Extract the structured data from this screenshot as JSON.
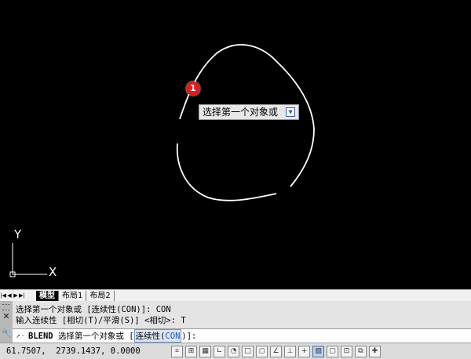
{
  "canvas": {
    "step_badge": "1",
    "tooltip": {
      "text": "选择第一个对象或"
    },
    "ucs": {
      "y_label": "Y",
      "x_label": "X"
    }
  },
  "tabs": [
    {
      "label": "模型",
      "active": true
    },
    {
      "label": "布局1",
      "active": false
    },
    {
      "label": "布局2",
      "active": false
    }
  ],
  "command": {
    "history": [
      "选择第一个对象或 [连续性(CON)]: CON",
      "输入连续性 [相切(T)/平滑(S)] <相切>: T"
    ],
    "current": {
      "name": "BLEND",
      "prompt": "选择第一个对象或",
      "option_open": "[",
      "option_text": "连续性(",
      "option_key": "CON",
      "option_close": ")]:",
      "close": ""
    }
  },
  "status": {
    "coordinates": "61.7507,  2739.1437, 0.0000",
    "buttons": [
      {
        "name": "infer-constraints-icon",
        "glyph": "⌗",
        "on": false
      },
      {
        "name": "snap-mode-icon",
        "glyph": "⊞",
        "on": false
      },
      {
        "name": "grid-display-icon",
        "glyph": "▦",
        "on": false
      },
      {
        "name": "ortho-mode-icon",
        "glyph": "∟",
        "on": false
      },
      {
        "name": "polar-tracking-icon",
        "glyph": "◔",
        "on": false
      },
      {
        "name": "object-snap-icon",
        "glyph": "□",
        "on": false
      },
      {
        "name": "3d-object-snap-icon",
        "glyph": "◻",
        "on": false
      },
      {
        "name": "object-snap-tracking-icon",
        "glyph": "∠",
        "on": false
      },
      {
        "name": "dynamic-ucs-icon",
        "glyph": "⊥",
        "on": false
      },
      {
        "name": "dynamic-input-icon",
        "glyph": "+",
        "on": false
      },
      {
        "name": "lineweight-icon",
        "glyph": "▨",
        "on": true
      },
      {
        "name": "transparency-icon",
        "glyph": "▢",
        "on": false
      },
      {
        "name": "quick-properties-icon",
        "glyph": "⊡",
        "on": false
      },
      {
        "name": "selection-cycling-icon",
        "glyph": "⧉",
        "on": false
      },
      {
        "name": "annotation-monitor-icon",
        "glyph": "✚",
        "on": false
      }
    ]
  }
}
